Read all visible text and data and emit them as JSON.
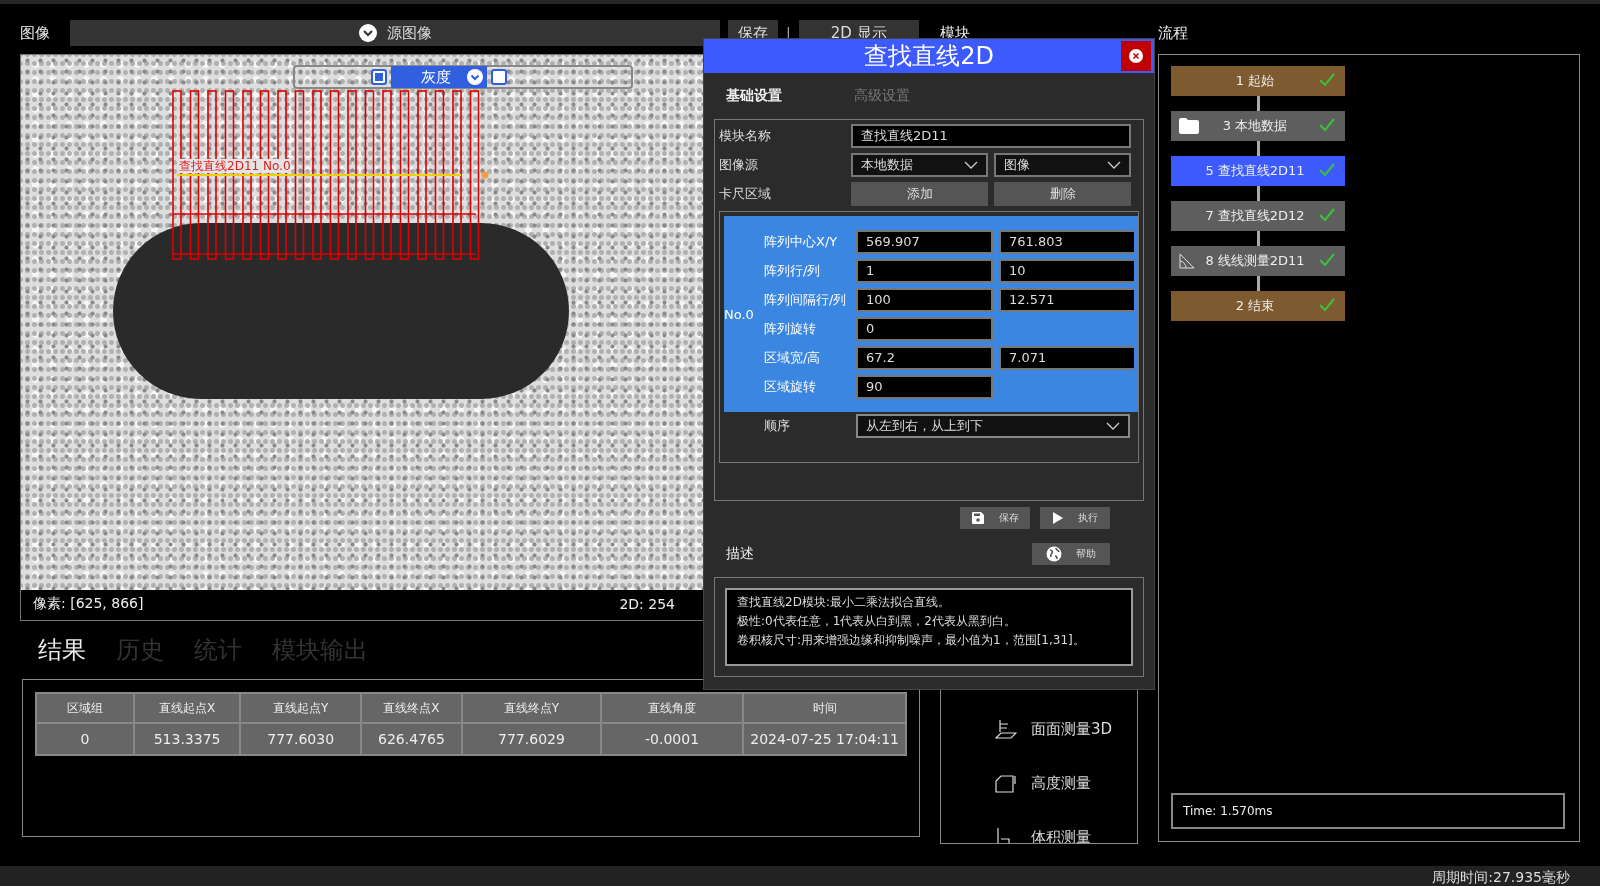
{
  "header": {
    "label": "图像",
    "source": "源图像",
    "save_button": "保存",
    "divider": "|",
    "view_button": "2D 显示"
  },
  "image": {
    "overlay": {
      "left_checked": true,
      "mode": "灰度",
      "right_checked": false
    },
    "caliper_label": "查找直线2D11 No.0",
    "pixel_readout": "像素: [625, 866]",
    "view_readout": "2D: 254"
  },
  "result_tabs": [
    {
      "label": "结果",
      "selected": true
    },
    {
      "label": "历史",
      "selected": false
    },
    {
      "label": "统计",
      "selected": false
    },
    {
      "label": "模块输出",
      "selected": false
    }
  ],
  "table": {
    "columns": [
      "区域组",
      "直线起点X",
      "直线起点Y",
      "直线终点X",
      "直线终点Y",
      "直线角度",
      "时间"
    ],
    "rows": [
      [
        "0",
        "513.3375",
        "777.6030",
        "626.4765",
        "777.6029",
        "-0.0001",
        "2024-07-25 17:04:11"
      ]
    ]
  },
  "modules": {
    "title": "模块",
    "items": [
      {
        "label": "面面测量3D",
        "kind": "plane"
      },
      {
        "label": "高度测量",
        "kind": "height"
      },
      {
        "label": "体积测量",
        "kind": "volume"
      }
    ]
  },
  "flow": {
    "title": "流程",
    "nodes": [
      {
        "label": "1 起始",
        "kind": "terminal",
        "selected": false,
        "done": true
      },
      {
        "label": "3 本地数据",
        "kind": "data",
        "selected": false,
        "done": true
      },
      {
        "label": "5 查找直线2D11",
        "kind": "step",
        "selected": true,
        "done": true
      },
      {
        "label": "7 查找直线2D12",
        "kind": "step",
        "selected": false,
        "done": true
      },
      {
        "label": "8 线线测量2D11",
        "kind": "measure",
        "selected": false,
        "done": true
      },
      {
        "label": "2 结束",
        "kind": "terminal",
        "selected": false,
        "done": true
      }
    ],
    "time": "Time: 1.570ms"
  },
  "dialog": {
    "title": "查找直线2D",
    "tabs": [
      {
        "label": "基础设置",
        "selected": true
      },
      {
        "label": "高级设置",
        "selected": false
      }
    ],
    "module_name": {
      "label": "模块名称",
      "value": "查找直线2D11"
    },
    "image_source": {
      "label": "图像源",
      "values": [
        "本地数据",
        "图像"
      ]
    },
    "caliper": {
      "label": "卡尺区域",
      "buttons": [
        "添加",
        "删除"
      ]
    },
    "array": {
      "group": "No.0",
      "rows": [
        {
          "label": "阵列中心X/Y",
          "values": [
            "569.907",
            "761.803"
          ]
        },
        {
          "label": "阵列行/列",
          "values": [
            "1",
            "10"
          ]
        },
        {
          "label": "阵列间隔行/列",
          "values": [
            "100",
            "12.571"
          ]
        },
        {
          "label": "阵列旋转",
          "values": [
            "0"
          ]
        },
        {
          "label": "区域宽/高",
          "values": [
            "67.2",
            "7.071"
          ]
        },
        {
          "label": "区域旋转",
          "values": [
            "90"
          ]
        }
      ]
    },
    "order": {
      "label": "顺序",
      "value": "从左到右，从上到下"
    },
    "actions": [
      {
        "label": "保存",
        "kind": "save"
      },
      {
        "label": "执行",
        "kind": "run"
      }
    ],
    "description_title": "描述",
    "help_button": "帮助",
    "description": [
      "查找直线2D模块:最小二乘法拟合直线。",
      "极性:0代表任意，1代表从白到黑，2代表从黑到白。",
      "卷积核尺寸:用来增强边缘和抑制噪声，最小值为1，范围[1,31]。"
    ]
  },
  "status": "周期时间:27.935毫秒"
}
